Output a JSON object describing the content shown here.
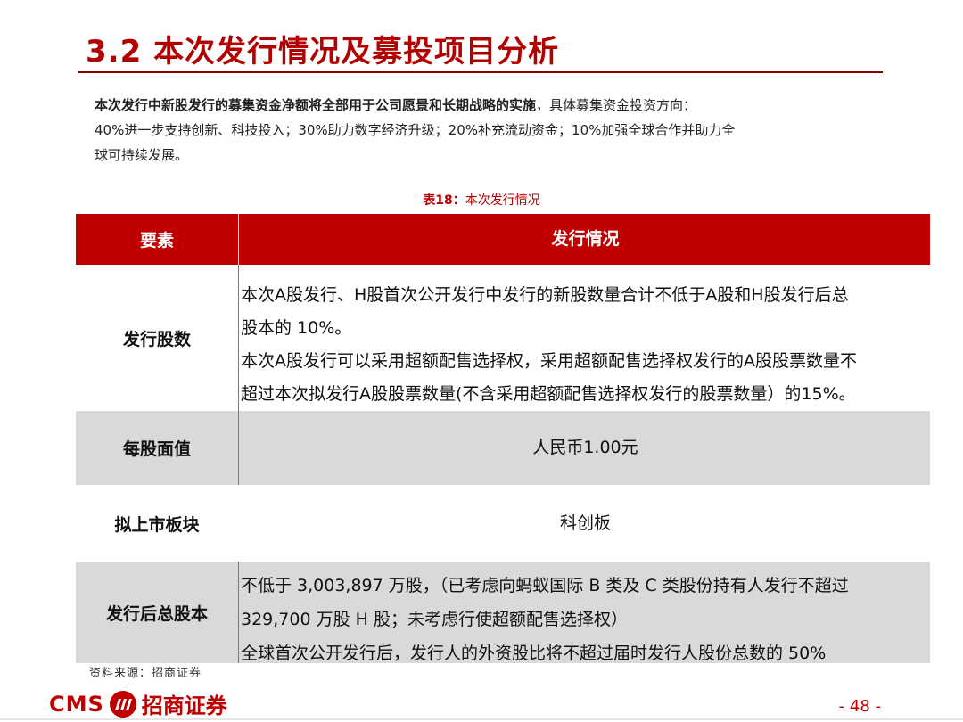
{
  "header": {
    "title": "3.2 本次发行情况及募投项目分析"
  },
  "intro": {
    "bold": "本次发行中新股发行的募集资金净额将全部用于公司愿景和长期战略的实施",
    "rest": "，具体募集资金投资方向：",
    "line2": "40%进一步支持创新、科技投入；30%助力数字经济升级；20%补充流动资金；10%加强全球合作并助力全",
    "line3": "球可持续发展。"
  },
  "table": {
    "caption_num": "表18：",
    "caption_text": "本次发行情况",
    "col_headers": [
      "要素",
      "发行情况"
    ],
    "rows": [
      {
        "label": "发行股数",
        "lines": [
          "本次A股发行、H股首次公开发行中发行的新股数量合计不低于A股和H股发行后总",
          "股本的 10%。",
          "本次A股发行可以采用超额配售选择权，采用超额配售选择权发行的A股股票数量不",
          "超过本次拟发行A股股票数量(不含采用超额配售选择权发行的股票数量）的15%。"
        ]
      },
      {
        "label": "每股面值",
        "value": "人民币1.00元"
      },
      {
        "label": "拟上市板块",
        "value": "科创板"
      },
      {
        "label": "发行后总股本",
        "lines": [
          "不低于 3,003,897 万股，（已考虑向蚂蚁国际 B 类及 C 类股份持有人发行不超过",
          "329,700 万股 H 股；未考虑行使超额配售选择权）",
          "全球首次公开发行后，发行人的外资股比将不超过届时发行人股份总数的 50%"
        ]
      }
    ]
  },
  "source": "资料来源：招商证券",
  "footer": {
    "logo_latin": "CMS",
    "logo_badge_icon": "cms-badge-icon",
    "logo_cn": "招商证券",
    "page_number": "- 48 -"
  },
  "colors": {
    "accent": "#c00000",
    "gray_row": "#d9d9d9"
  }
}
